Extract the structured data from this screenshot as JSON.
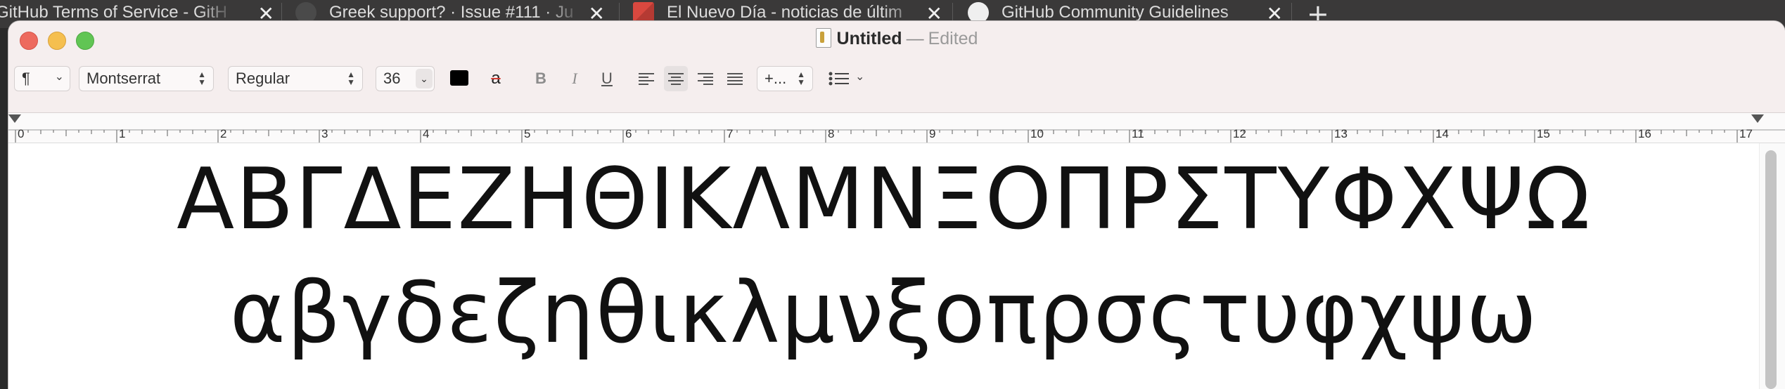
{
  "browser": {
    "tabs": [
      {
        "label": "GitHub Terms of Service - GitH",
        "close": "✕",
        "favicon": "github-icon"
      },
      {
        "label": "Greek support? · Issue #111 · Ju",
        "close": "✕",
        "favicon": "github-icon"
      },
      {
        "label": "El Nuevo Día - noticias de últim",
        "close": "✕",
        "favicon": "el-nuevo-dia-icon"
      },
      {
        "label": "GitHub Community Guidelines",
        "close": "✕",
        "favicon": "github-icon"
      }
    ],
    "new_tab": "+"
  },
  "window": {
    "title": "Untitled",
    "separator": "—",
    "status": "Edited"
  },
  "toolbar": {
    "paragraph_symbol": "¶",
    "font_family": "Montserrat",
    "font_style": "Regular",
    "font_size": "36",
    "text_color": "#000000",
    "bold": "B",
    "italic": "I",
    "underline": "U",
    "spacing": "+...",
    "highlight_glyph": "a"
  },
  "ruler": {
    "labels": [
      "0",
      "1",
      "2",
      "3",
      "4",
      "5",
      "6",
      "7",
      "8",
      "9",
      "10",
      "11",
      "12",
      "13",
      "14",
      "15",
      "16",
      "17"
    ]
  },
  "document": {
    "uppercase": "ΑΒΓΔΕΖΗΘΙΚΛΜΝΞΟΠΡΣΤΥΦΧΨΩ",
    "lowercase": "αβγδεζηθικλμνξοπρσςτυφχψω"
  },
  "colors": {
    "close": "#ed6a5e",
    "minimize": "#f5bf4f",
    "maximize": "#61c554"
  }
}
